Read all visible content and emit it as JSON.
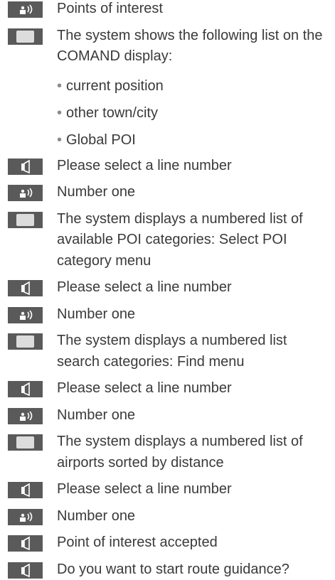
{
  "rows": [
    {
      "icon": "voice-command-icon",
      "text": "Points of interest"
    },
    {
      "icon": "display-icon",
      "text": "The system shows the following list on the COMAND display:"
    },
    {
      "icon": "none",
      "bullets": [
        "current position",
        "other town/city",
        "Global POI"
      ]
    },
    {
      "icon": "speaker-icon",
      "text": "Please select a line number"
    },
    {
      "icon": "voice-command-icon",
      "text": "Number one"
    },
    {
      "icon": "display-icon",
      "text": "The system displays a numbered list of available POI categories: Select POI category menu"
    },
    {
      "icon": "speaker-icon",
      "text": "Please select a line number"
    },
    {
      "icon": "voice-command-icon",
      "text": "Number one"
    },
    {
      "icon": "display-icon",
      "text": "The system displays a numbered list search categories: Find menu"
    },
    {
      "icon": "speaker-icon",
      "text": "Please select a line number"
    },
    {
      "icon": "voice-command-icon",
      "text": "Number one"
    },
    {
      "icon": "display-icon",
      "text": "The system displays a numbered list of airports sorted by distance"
    },
    {
      "icon": "speaker-icon",
      "text": "Please select a line number"
    },
    {
      "icon": "voice-command-icon",
      "text": "Number one"
    },
    {
      "icon": "speaker-icon",
      "text": "Point of interest accepted"
    },
    {
      "icon": "speaker-icon",
      "text": "Do you want to start route guidance?"
    }
  ],
  "colors": {
    "icon_bg": "#5a5a5a",
    "text": "#3a3a3a",
    "bullet": "#8a8a8a"
  }
}
